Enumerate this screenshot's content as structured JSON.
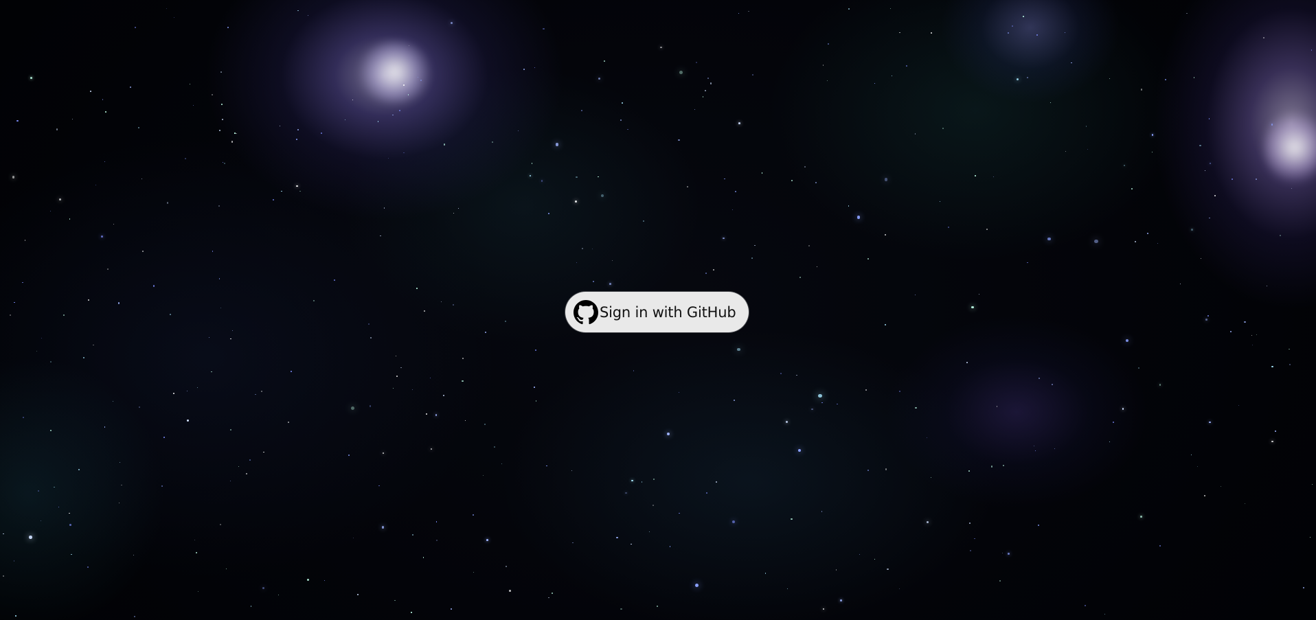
{
  "login": {
    "button_label": "Sign in with GitHub",
    "button_icon": "github-icon",
    "button_background": "#e9e9e9",
    "button_text_color": "#111111"
  },
  "background": {
    "theme": "starfield-nebula",
    "base_color": "#020308"
  }
}
